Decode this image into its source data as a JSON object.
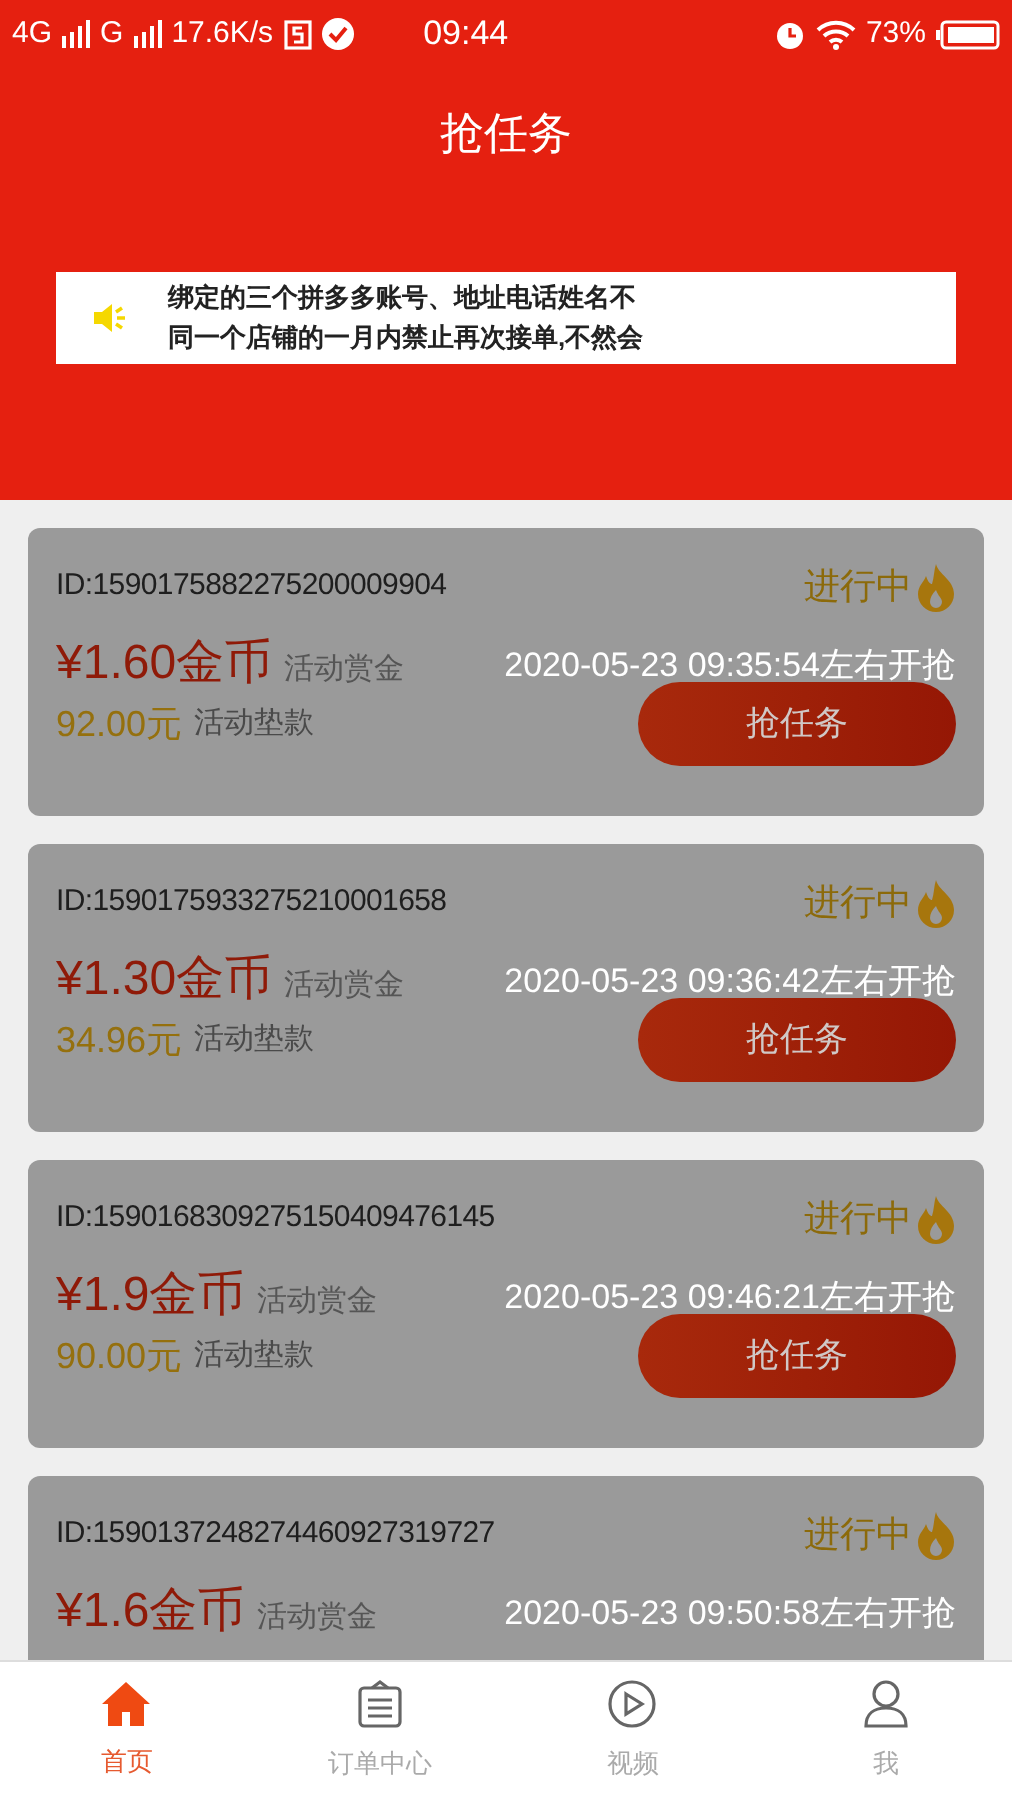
{
  "status_bar": {
    "network_1": "4G",
    "network_2": "G",
    "speed": "17.6K/s",
    "time": "09:44",
    "battery": "73%"
  },
  "title": "抢任务",
  "notice": {
    "lines": [
      "绑定的三个拼多多账号、地址电话姓名不",
      "同一个店铺的一月内禁止再次接单,不然会"
    ]
  },
  "tasks": [
    {
      "id": "ID:1590175882275200009904",
      "status": "进行中",
      "reward": "¥1.60金币",
      "reward_label": "活动赏金",
      "deposit": "92.00元",
      "deposit_label": "活动垫款",
      "button": "抢任务",
      "start_time": "2020-05-23 09:35:54左右开抢"
    },
    {
      "id": "ID:1590175933275210001658",
      "status": "进行中",
      "reward": "¥1.30金币",
      "reward_label": "活动赏金",
      "deposit": "34.96元",
      "deposit_label": "活动垫款",
      "button": "抢任务",
      "start_time": "2020-05-23 09:36:42左右开抢"
    },
    {
      "id": "ID:1590168309275150409476145",
      "status": "进行中",
      "reward": "¥1.9金币",
      "reward_label": "活动赏金",
      "deposit": "90.00元",
      "deposit_label": "活动垫款",
      "button": "抢任务",
      "start_time": "2020-05-23 09:46:21左右开抢"
    },
    {
      "id": "ID:1590137248274460927319727",
      "status": "进行中",
      "reward": "¥1.6金币",
      "reward_label": "活动赏金",
      "start_time": "2020-05-23 09:50:58左右开抢"
    }
  ],
  "tab_bar": [
    {
      "label": "首页",
      "selected": true
    },
    {
      "label": "订单中心",
      "selected": false
    },
    {
      "label": "视频",
      "selected": false
    },
    {
      "label": "我",
      "selected": false
    }
  ]
}
